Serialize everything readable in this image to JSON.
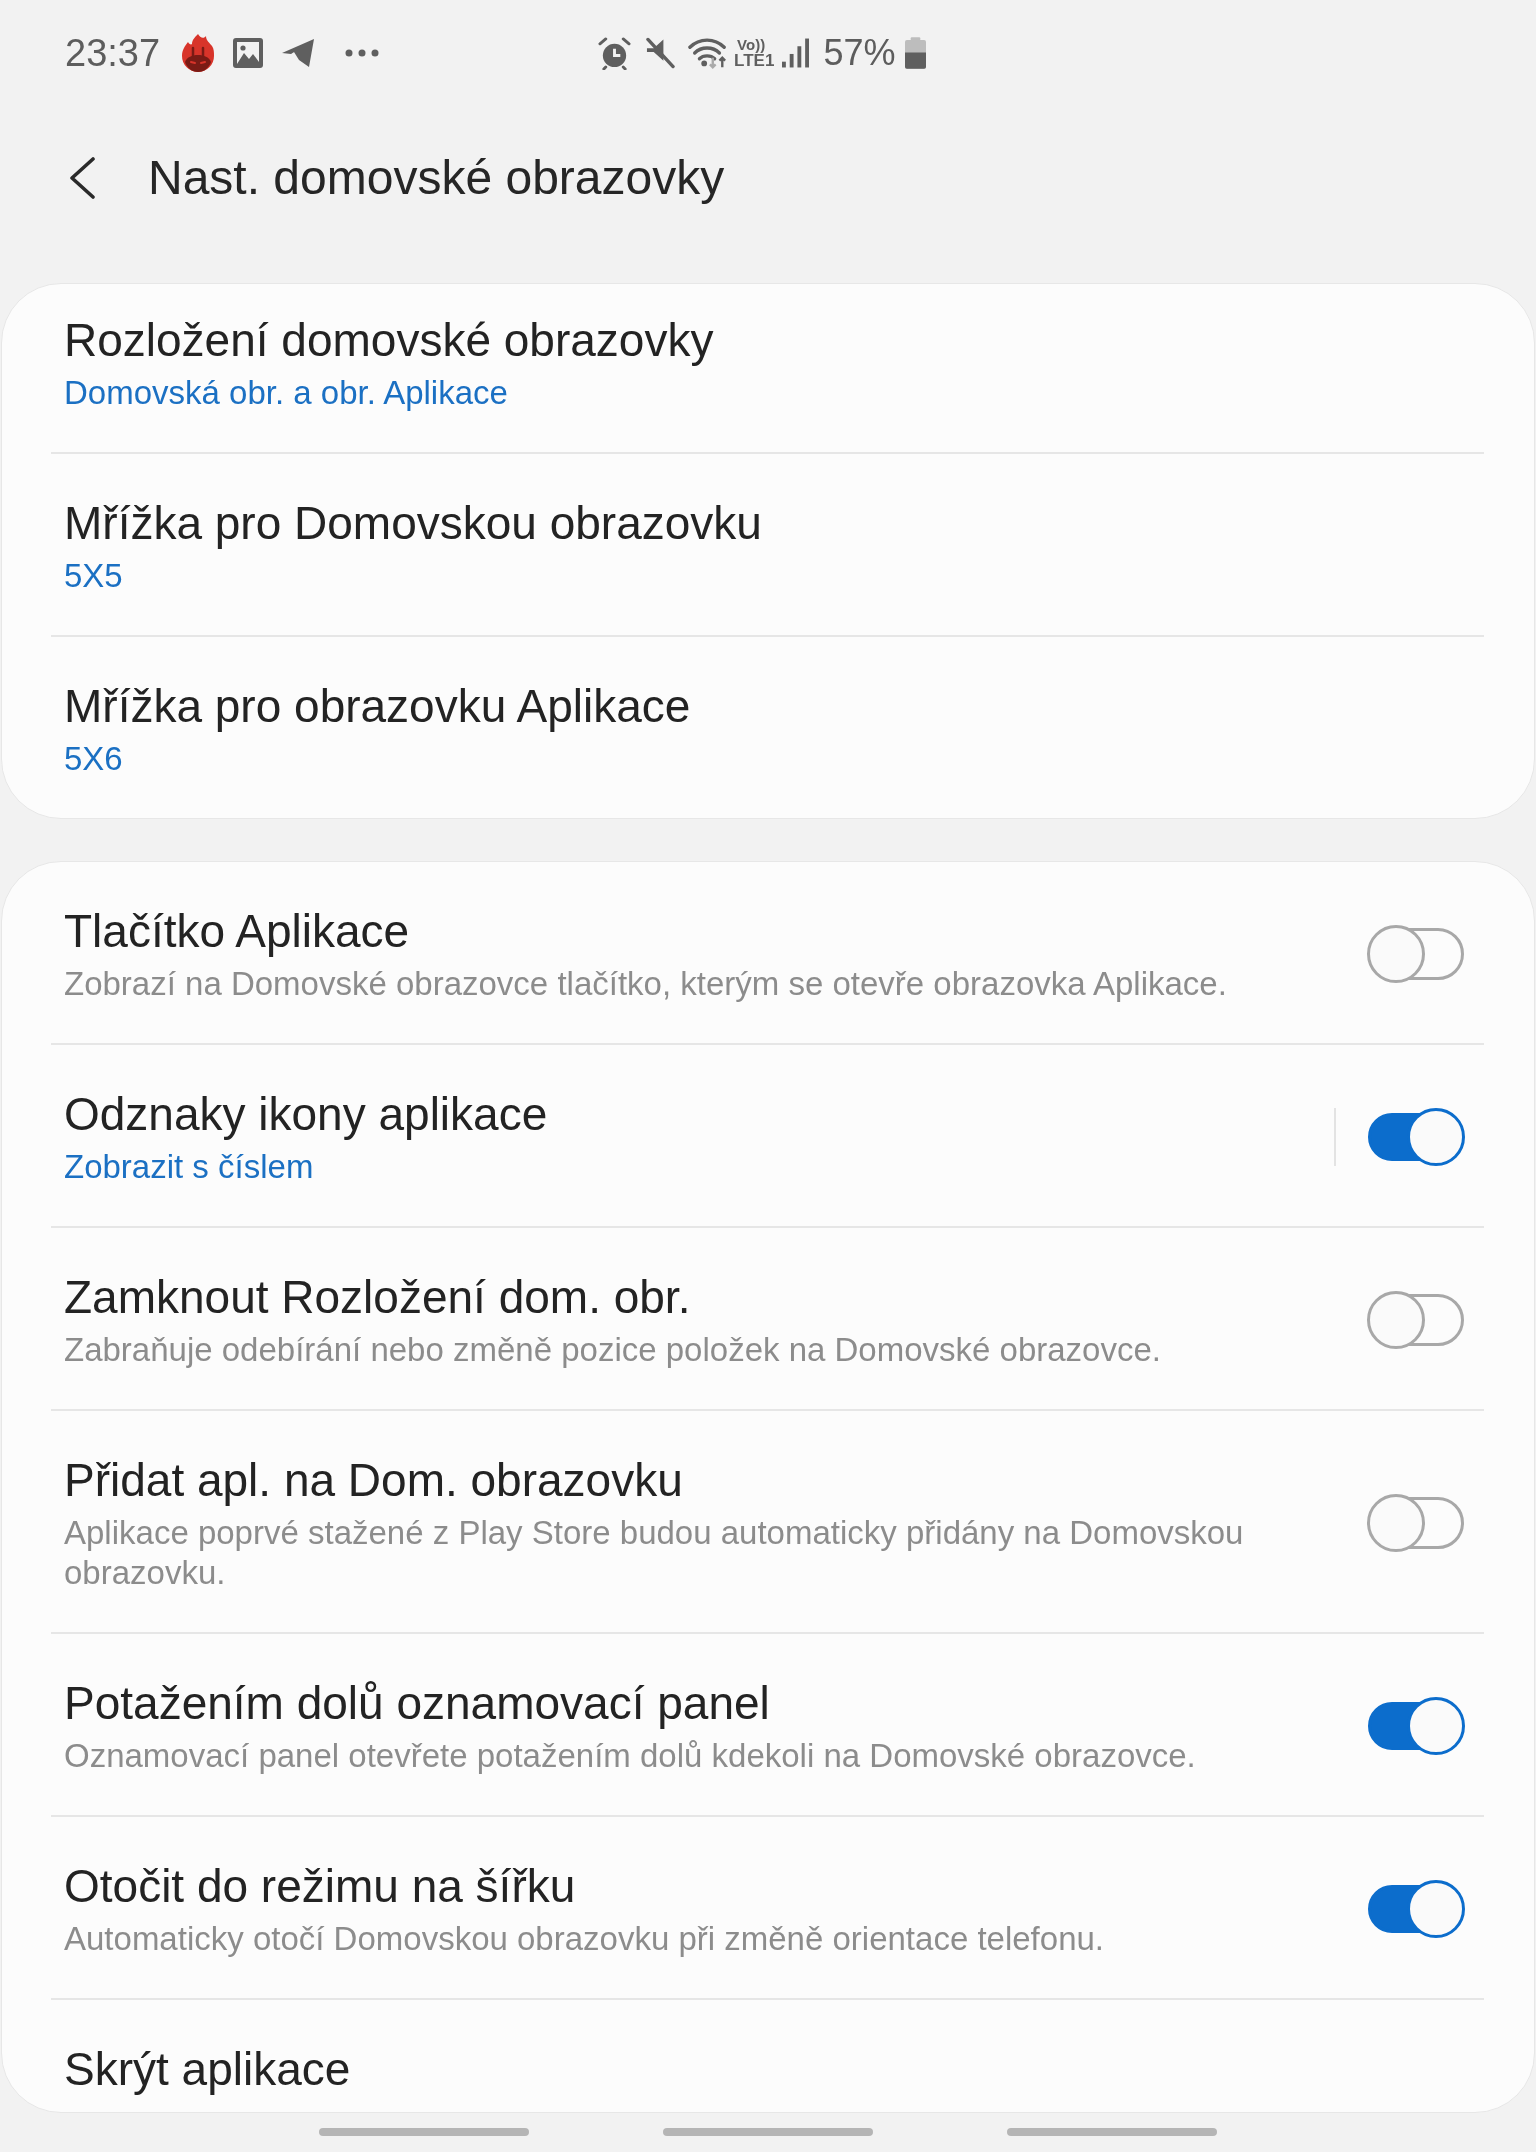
{
  "status_bar": {
    "time": "23:37",
    "volte_label": "Vo))",
    "network_label": "LTE1",
    "battery": "57%"
  },
  "header": {
    "title": "Nast. domovské obrazovky"
  },
  "groups": [
    {
      "items": [
        {
          "kind": "nav",
          "title": "Rozložení domovské obrazovky",
          "value": "Domovská obr. a obr. Aplikace"
        },
        {
          "kind": "nav",
          "title": "Mřížka pro Domovskou obrazovku",
          "value": "5X5"
        },
        {
          "kind": "nav",
          "title": "Mřížka pro obrazovku Aplikace",
          "value": "5X6"
        }
      ]
    },
    {
      "items": [
        {
          "kind": "switch",
          "title": "Tlačítko Aplikace",
          "description": "Zobrazí na Domovské obrazovce tlačítko, kterým se otevře obrazovka Aplikace.",
          "on": false
        },
        {
          "kind": "nav_switch",
          "title": "Odznaky ikony aplikace",
          "value": "Zobrazit s číslem",
          "on": true
        },
        {
          "kind": "switch",
          "title": "Zamknout Rozložení dom. obr.",
          "description": "Zabraňuje odebírání nebo změně pozice položek na Domovské obrazovce.",
          "on": false
        },
        {
          "kind": "switch",
          "title": "Přidat apl. na Dom. obrazovku",
          "description": "Aplikace poprvé stažené z Play Store budou automaticky přidány na Domovskou obrazovku.",
          "on": false
        },
        {
          "kind": "switch",
          "title": "Potažením dolů oznamovací panel",
          "description": "Oznamovací panel otevřete potažením dolů kdekoli na Domovské obrazovce.",
          "on": true
        },
        {
          "kind": "switch",
          "title": "Otočit do režimu na šířku",
          "description": "Automaticky otočí Domovskou obrazovku při změně orientace telefonu.",
          "on": true
        },
        {
          "kind": "nav",
          "title": "Skrýt aplikace"
        }
      ]
    }
  ]
}
